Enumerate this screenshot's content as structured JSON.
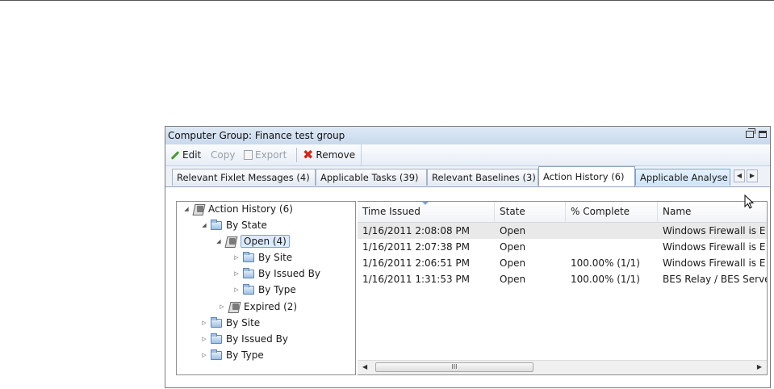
{
  "window": {
    "title": "Computer Group: Finance test group"
  },
  "toolbar": {
    "edit": "Edit",
    "copy": "Copy",
    "export": "Export",
    "remove": "Remove"
  },
  "tabs": [
    {
      "label": "Relevant Fixlet Messages (4)"
    },
    {
      "label": "Applicable Tasks (39)"
    },
    {
      "label": "Relevant Baselines (3)"
    },
    {
      "label": "Action History (6)",
      "active": true
    },
    {
      "label": "Applicable Analyse"
    }
  ],
  "tree": [
    {
      "label": "Action History (6)"
    },
    {
      "label": "By State"
    },
    {
      "label": "Open (4)",
      "selected": true
    },
    {
      "label": "By Site"
    },
    {
      "label": "By Issued By"
    },
    {
      "label": "By Type"
    },
    {
      "label": "Expired (2)"
    },
    {
      "label": "By Site"
    },
    {
      "label": "By Issued By"
    },
    {
      "label": "By Type"
    }
  ],
  "grid": {
    "columns": [
      "Time Issued",
      "State",
      "% Complete",
      "Name"
    ],
    "rows": [
      [
        "1/16/2011 2:08:08 PM",
        "Open",
        "",
        "Windows Firewall is E"
      ],
      [
        "1/16/2011 2:07:38 PM",
        "Open",
        "",
        "Windows Firewall is E"
      ],
      [
        "1/16/2011 2:06:51 PM",
        "Open",
        "100.00% (1/1)",
        "Windows Firewall is E"
      ],
      [
        "1/16/2011 1:31:53 PM",
        "Open",
        "100.00% (1/1)",
        "BES Relay / BES Serve"
      ]
    ],
    "scroll_thumb_label": "III"
  },
  "colors": {
    "accent": "#7aa6d2",
    "title_bar": "#c9d9ec",
    "remove_icon": "#d4261c",
    "edit_icon": "#4a9a2a"
  }
}
